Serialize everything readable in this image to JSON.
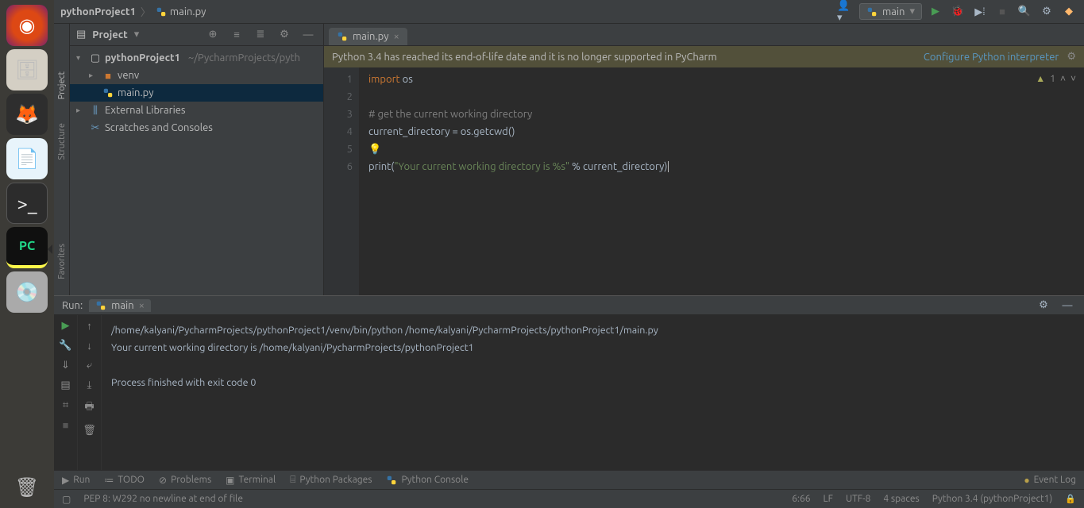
{
  "dock": {
    "items": [
      "ubuntu",
      "files",
      "firefox",
      "writer",
      "terminal",
      "pycharm",
      "disk",
      "trash"
    ]
  },
  "breadcrumbs": {
    "project": "pythonProject1",
    "file": "main.py"
  },
  "runconfig": {
    "label": "main"
  },
  "project_panel": {
    "title": "Project",
    "root": "pythonProject1",
    "root_path": "~/PycharmProjects/pyth",
    "items": {
      "venv": "venv",
      "main": "main.py",
      "ext": "External Libraries",
      "scratches": "Scratches and Consoles"
    }
  },
  "editor": {
    "tab": "main.py",
    "banner_msg": "Python 3.4 has reached its end-of-life date and it is no longer supported in PyCharm",
    "banner_link": "Configure Python interpreter",
    "inspection_warn": "1",
    "lines": {
      "l1a": "import",
      "l1b": " os",
      "l3": "# get the current working directory",
      "l4a": "current_directory = os.getcwd()",
      "l6a": "print",
      "l6b": "(",
      "l6c": "\"Your current working directory is %s\"",
      "l6d": " % current_directory)"
    },
    "gutter": [
      "1",
      "2",
      "3",
      "4",
      "5",
      "6"
    ]
  },
  "run": {
    "title": "Run:",
    "tab": "main",
    "out1": "/home/kalyani/PycharmProjects/pythonProject1/venv/bin/python /home/kalyani/PycharmProjects/pythonProject1/main.py",
    "out2": "Your current working directory is /home/kalyani/PycharmProjects/pythonProject1",
    "out3": "Process finished with exit code 0"
  },
  "bottom": {
    "run": "Run",
    "todo": "TODO",
    "problems": "Problems",
    "terminal": "Terminal",
    "pypkg": "Python Packages",
    "pycon": "Python Console",
    "eventlog": "Event Log"
  },
  "status": {
    "pep": "PEP 8: W292 no newline at end of file",
    "pos": "6:66",
    "lf": "LF",
    "enc": "UTF-8",
    "indent": "4 spaces",
    "interp": "Python 3.4 (pythonProject1)"
  },
  "sidetabs": {
    "project": "Project",
    "structure": "Structure",
    "favorites": "Favorites"
  }
}
